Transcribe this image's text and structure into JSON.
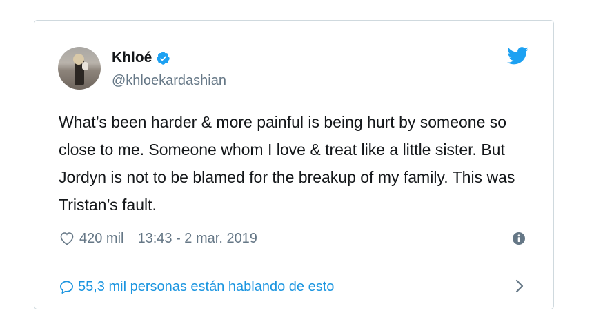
{
  "tweet": {
    "author_name": "Khloé",
    "handle": "@khloekardashian",
    "verified": true,
    "text": "What’s been harder & more painful is being hurt by someone so close to me. Someone whom I love & treat like a little sister. But Jordyn is not to be blamed for the breakup of my family. This was Tristan’s fault.",
    "likes": "420 mil",
    "timestamp": "13:43 - 2 mar. 2019",
    "conversation_link": "55,3 mil personas están hablando de esto"
  },
  "icons": {
    "brand": "twitter-bird-icon",
    "verified": "verified-badge-icon",
    "like": "heart-icon",
    "info": "info-icon",
    "conversation": "speech-bubble-icon",
    "navigate": "chevron-right-icon"
  },
  "colors": {
    "brand_blue": "#1da1f2",
    "link_blue": "#1b95e0",
    "text": "#14171a",
    "secondary_text": "#657786",
    "border": "#cfd9de"
  }
}
